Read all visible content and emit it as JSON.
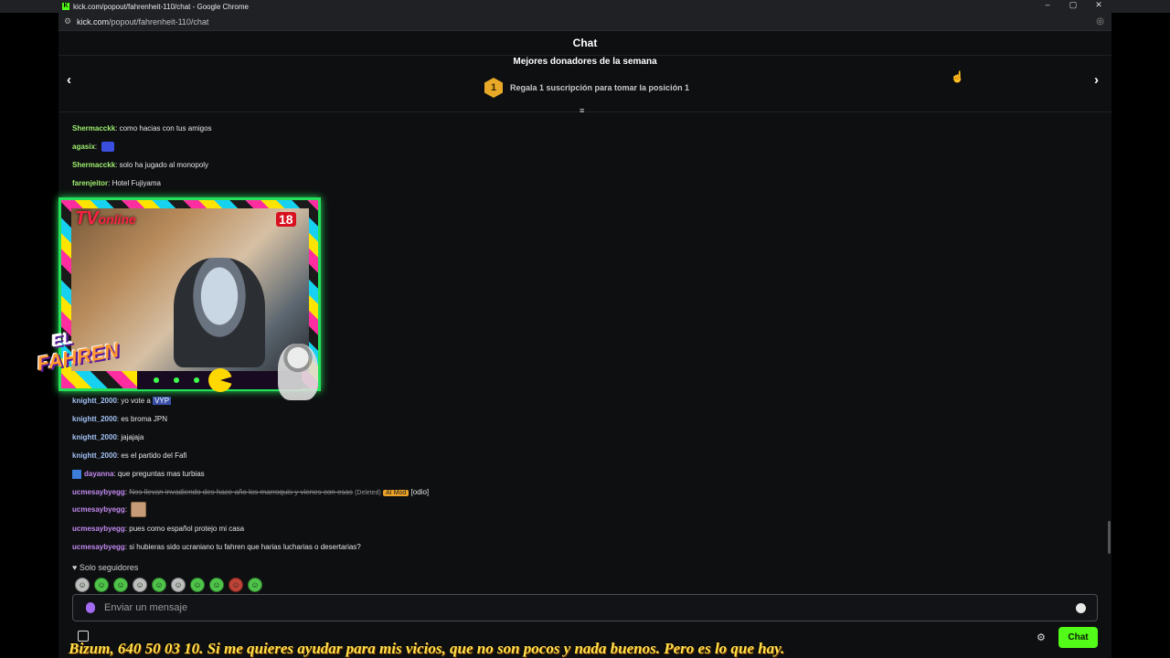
{
  "window": {
    "title": "kick.com/popout/fahrenheit-110/chat - Google Chrome",
    "controls": [
      "–",
      "▢",
      "✕"
    ]
  },
  "address_bar": {
    "host": "kick.com",
    "path": "/popout/fahrenheit-110/chat"
  },
  "header": {
    "title": "Chat"
  },
  "donors": {
    "title": "Mejores donadores de la semana",
    "rank": "1",
    "promo": "Regala 1 suscripción para tomar la posición 1"
  },
  "messages": [
    {
      "user": "Shermacckk",
      "color": "green",
      "text": "como hacias con tus amigos"
    },
    {
      "user": "agasix",
      "color": "green",
      "text": ""
    },
    {
      "user": "Shermacckk",
      "color": "green",
      "text": "solo ha jugado al monopoly"
    },
    {
      "user": "farenjeitor",
      "color": "green",
      "text": "Hotel Fujiyama"
    },
    {
      "user": "knightt_2000",
      "color": "blue",
      "text": "yo vote a",
      "highlight": "VYP"
    },
    {
      "user": "knightt_2000",
      "color": "blue",
      "text": "es broma JPN"
    },
    {
      "user": "knightt_2000",
      "color": "blue",
      "text": "jajajaja"
    },
    {
      "user": "knightt_2000",
      "color": "blue",
      "text": "es el partido del Fafi"
    },
    {
      "user": "dayanna",
      "color": "purple",
      "text": "que preguntas mas turbias"
    },
    {
      "user": "ucmesaybyegg",
      "color": "purple",
      "text": "Nos llevan invadiendo des hace año los marroquis y vienes con esas",
      "deleted": "(Deleted)",
      "mod": "AI Mod",
      "tag": "[odio]"
    },
    {
      "user": "ucmesaybyegg",
      "color": "purple",
      "text": ""
    },
    {
      "user": "ucmesaybyegg",
      "color": "purple",
      "text": "pues como español protejo mi casa"
    },
    {
      "user": "ucmesaybyegg",
      "color": "purple",
      "text": "si hubieras sido ucraniano tu fahren que harias lucharias o desertarias?"
    }
  ],
  "overlay": {
    "tv_label": "TV",
    "tv_sub": "online",
    "age": "18",
    "logo_top": "EL",
    "logo_bottom": "FAHREN"
  },
  "solo_seguidores": "Solo seguidores",
  "input": {
    "placeholder": "Enviar un mensaje"
  },
  "chat_button": "Chat",
  "ticker": "Bizum, 640 50 03 10.  Si me quieres ayudar para mis vicios, que no son pocos y nada buenos. Pero es lo que hay.",
  "colors": {
    "accent": "#53fc18",
    "background": "#0e0f11",
    "ticker": "#ffe24a"
  }
}
